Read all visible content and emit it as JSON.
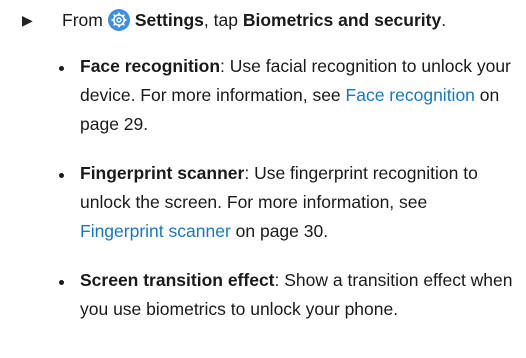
{
  "step": {
    "prefix": "From",
    "settings_label": "Settings",
    "middle": ", tap",
    "target_label": "Biometrics and security",
    "suffix": "."
  },
  "items": [
    {
      "title": "Face recognition",
      "text_a": ": Use facial recognition to unlock your device. For more information, see ",
      "link": "Face recognition",
      "text_b": " on page 29."
    },
    {
      "title": "Fingerprint scanner",
      "text_a": ": Use fingerprint recognition to unlock the screen. For more information, see ",
      "link": "Fingerprint scanner",
      "text_b": " on page 30."
    },
    {
      "title": "Screen transition effect",
      "text_a": ": Show a transition effect when you use biometrics to unlock your phone.",
      "link": "",
      "text_b": ""
    }
  ],
  "icons": {
    "arrow": "play-arrow-icon",
    "settings": "settings-gear-icon"
  },
  "colors": {
    "link": "#1479c4",
    "settings_icon": "#3d8fe0"
  }
}
